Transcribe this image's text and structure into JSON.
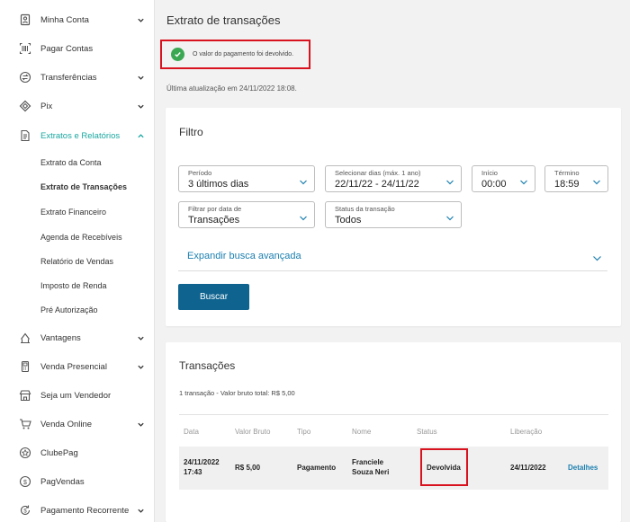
{
  "sidebar": {
    "items": [
      {
        "label": "Minha Conta",
        "icon": "user-icon"
      },
      {
        "label": "Pagar Contas",
        "icon": "barcode-icon"
      },
      {
        "label": "Transferências",
        "icon": "transfer-icon"
      },
      {
        "label": "Pix",
        "icon": "pix-icon"
      },
      {
        "label": "Extratos e Relatórios",
        "icon": "document-icon"
      },
      {
        "label": "Vantagens",
        "icon": "gift-icon"
      },
      {
        "label": "Venda Presencial",
        "icon": "card-machine-icon"
      },
      {
        "label": "Seja um Vendedor",
        "icon": "store-icon"
      },
      {
        "label": "Venda Online",
        "icon": "cart-icon"
      },
      {
        "label": "ClubePag",
        "icon": "star-badge-icon"
      },
      {
        "label": "PagVendas",
        "icon": "coin-icon"
      },
      {
        "label": "Pagamento Recorrente",
        "icon": "recurring-icon"
      }
    ],
    "subitems": [
      {
        "label": "Extrato da Conta"
      },
      {
        "label": "Extrato de Transações"
      },
      {
        "label": "Extrato Financeiro"
      },
      {
        "label": "Agenda de Recebíveis"
      },
      {
        "label": "Relatório de Vendas"
      },
      {
        "label": "Imposto de Renda"
      },
      {
        "label": "Pré Autorização"
      }
    ],
    "active_color": "#1aa7a0"
  },
  "page": {
    "title": "Extrato de transações",
    "alert_message": "O valor do pagamento foi devolvido.",
    "last_update": "Última atualização em 24/11/2022 18:08."
  },
  "filter": {
    "title": "Filtro",
    "periodo": {
      "label": "Período",
      "value": "3 últimos dias"
    },
    "dias": {
      "label": "Selecionar dias (máx. 1 ano)",
      "value": "22/11/22 - 24/11/22"
    },
    "inicio": {
      "label": "Início",
      "value": "00:00"
    },
    "termino": {
      "label": "Término",
      "value": "18:59"
    },
    "filtrar_por": {
      "label": "Filtrar por data de",
      "value": "Transações"
    },
    "status": {
      "label": "Status da transação",
      "value": "Todos"
    },
    "expand_label": "Expandir busca avançada",
    "search_button": "Buscar"
  },
  "transactions": {
    "title": "Transações",
    "summary": "1 transação - Valor bruto total: R$ 5,00",
    "headers": {
      "data": "Data",
      "valor_bruto": "Valor Bruto",
      "tipo": "Tipo",
      "nome": "Nome",
      "status": "Status",
      "liberacao": "Liberação"
    },
    "row": {
      "data_line1": "24/11/2022",
      "data_line2": "17:43",
      "valor_bruto": "R$ 5,00",
      "tipo": "Pagamento",
      "nome_line1": "Franciele",
      "nome_line2": "Souza Neri",
      "status": "Devolvida",
      "liberacao": "24/11/2022",
      "action": "Detalhes"
    }
  },
  "colors": {
    "primary_button": "#0e638f",
    "link": "#1b7fb0",
    "highlight_border": "#d8121e",
    "success": "#3aa852"
  }
}
